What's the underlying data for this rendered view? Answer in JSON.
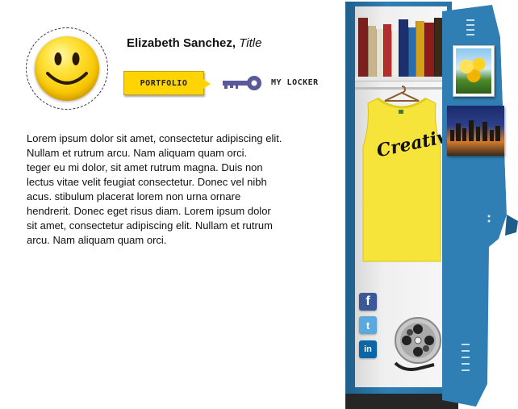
{
  "profile": {
    "name": "Elizabeth Sanchez,",
    "title": "Title",
    "avatar_icon": "smiley-face"
  },
  "nav": {
    "portfolio_label": "PORTFOLIO",
    "locker_label": "MY LOCKER",
    "portfolio_color": "#ffd400",
    "key_icon": "key-icon",
    "key_color": "#5a5a9a"
  },
  "bio": {
    "text": "Lorem ipsum dolor sit amet, consectetur adipiscing elit.\nNullam et rutrum arcu. Nam aliquam quam orci.\nteger eu mi dolor, sit amet rutrum magna. Duis non\nlectus vitae velit feugiat consectetur. Donec vel nibh\nacus. stibulum placerat lorem non urna ornare\n hendrerit. Donec eget risus diam. Lorem ipsum dolor\nsit amet, consectetur adipiscing elit. Nullam et rutrum\narcu. Nam aliquam quam orci."
  },
  "locker": {
    "shirt_text": "Creative",
    "shirt_color": "#f7e43a",
    "locker_color": "#2f7fb4",
    "social": {
      "facebook": "f",
      "twitter": "t",
      "linkedin": "in"
    },
    "icons": [
      "facebook-icon",
      "twitter-icon",
      "linkedin-icon",
      "film-reel-icon"
    ]
  }
}
